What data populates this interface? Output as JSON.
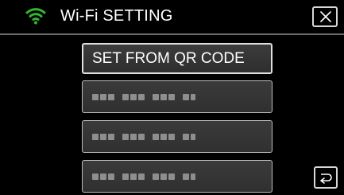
{
  "header": {
    "title": "Wi-Fi SETTING",
    "wifi_icon": "wifi-icon",
    "close_icon": "close-x-icon",
    "accent_color": "#2fb82f"
  },
  "options": [
    {
      "label": "SET FROM QR CODE"
    },
    {
      "label": "",
      "icon": "network-name-placeholder"
    },
    {
      "label": "",
      "icon": "network-name-placeholder"
    },
    {
      "label": "",
      "icon": "network-name-placeholder"
    }
  ],
  "footer": {
    "back_icon": "return-arrow-icon"
  }
}
